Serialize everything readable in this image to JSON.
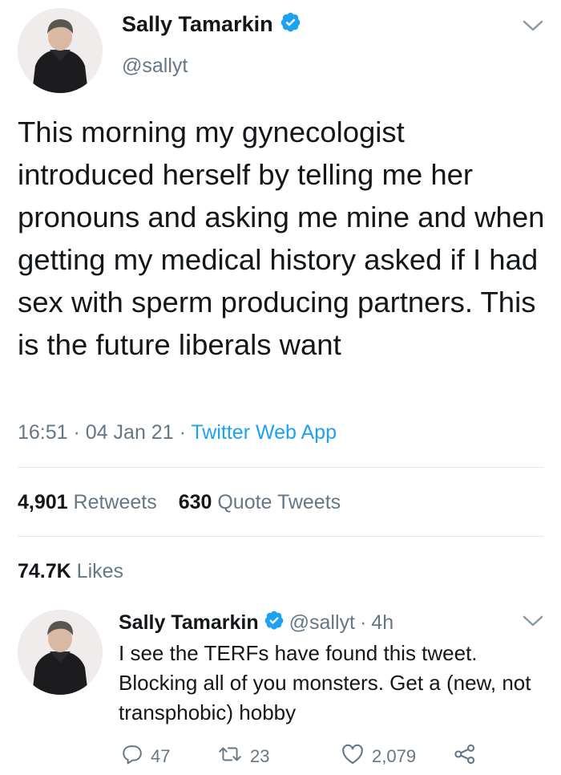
{
  "tweet": {
    "author_name": "Sally Tamarkin",
    "author_handle": "@sallyt",
    "text": "This morning my gynecologist introduced herself by telling me her pronouns and asking me mine and when getting my medical history asked if I had sex with sperm producing partners. This is the future liberals want",
    "time": "16:51",
    "date": "04 Jan 21",
    "source": "Twitter Web App",
    "retweets_count": "4,901",
    "retweets_label": "Retweets",
    "quotes_count": "630",
    "quotes_label": "Quote Tweets",
    "likes_count": "74.7K",
    "likes_label": "Likes"
  },
  "reply": {
    "author_name": "Sally Tamarkin",
    "author_handle": "@sallyt",
    "age": "4h",
    "text": "I see the TERFs have found this tweet. Blocking all of you monsters. Get a (new, not transphobic) hobby",
    "reply_count": "47",
    "retweet_count": "23",
    "like_count": "2,079"
  },
  "colors": {
    "accent": "#1da1f2",
    "secondary_text": "#657786",
    "primary_text": "#14171a"
  },
  "icons": [
    "verified-icon",
    "chevron-down-icon",
    "reply-icon",
    "retweet-icon",
    "like-icon",
    "share-icon"
  ]
}
